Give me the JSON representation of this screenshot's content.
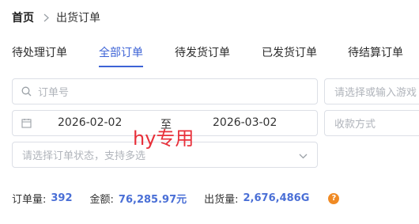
{
  "breadcrumb": {
    "home": "首页",
    "current": "出货订单"
  },
  "tabs": [
    {
      "label": "待处理订单"
    },
    {
      "label": "全部订单"
    },
    {
      "label": "待发货订单"
    },
    {
      "label": "已发货订单"
    },
    {
      "label": "待结算订单"
    }
  ],
  "active_tab": "全部订单",
  "filters": {
    "order_search_placeholder": "订单号",
    "game_select_placeholder": "请选择或输入游戏",
    "date_start": "2026-02-02",
    "date_separator": "至",
    "date_end": "2026-03-02",
    "pay_method_placeholder": "收款方式",
    "status_placeholder": "请选择订单状态，支持多选"
  },
  "watermark": "hy专用",
  "stats": {
    "order_count_label": "订单量:",
    "order_count": "392",
    "amount_label": "金额:",
    "amount": "76,285.97元",
    "shipped_label": "出货量:",
    "shipped": "2,676,486G",
    "help_icon_text": "?"
  },
  "colors": {
    "accent": "#3d63d6",
    "stat_value": "#4a6fd6",
    "watermark": "#e8303a",
    "help_icon": "#f08a24"
  },
  "icons": [
    "chevron-right-icon",
    "search-icon",
    "calendar-icon",
    "chevron-down-icon",
    "help-icon"
  ]
}
